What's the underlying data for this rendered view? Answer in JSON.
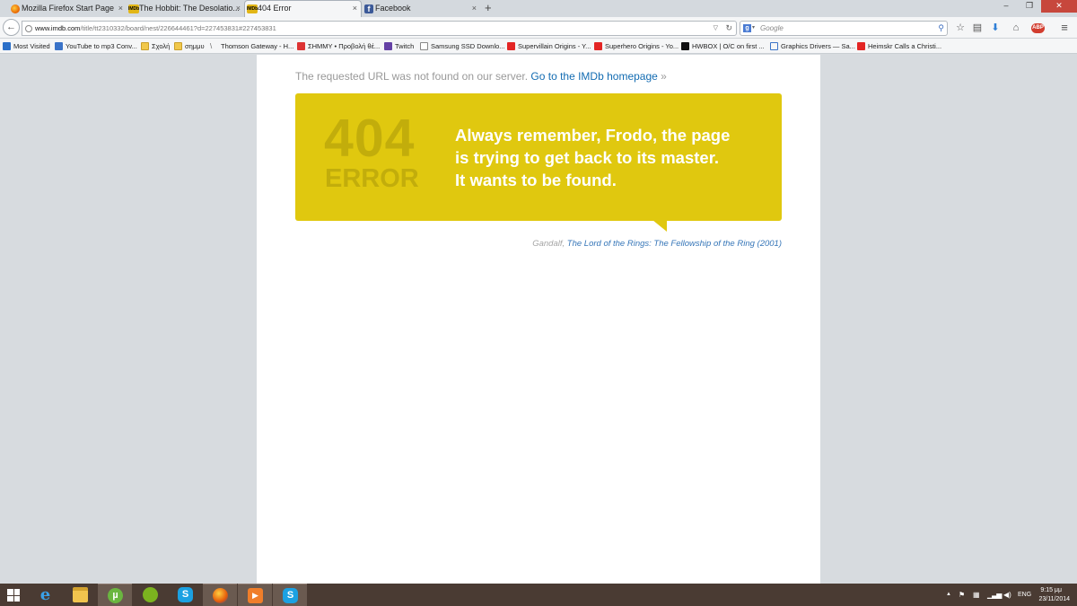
{
  "browser": {
    "tabs": [
      {
        "title": "Mozilla Firefox Start Page",
        "favicon": "firefox-icon"
      },
      {
        "title": "The Hobbit: The Desolatio...",
        "favicon": "imdb-icon"
      },
      {
        "title": "404 Error",
        "favicon": "imdb-icon"
      },
      {
        "title": "Facebook",
        "favicon": "facebook-icon"
      }
    ],
    "tab_close_glyph": "×",
    "new_tab_glyph": "+",
    "window_controls": {
      "minimize": "–",
      "restore": "❐",
      "close": "✕"
    },
    "nav": {
      "back_glyph": "←",
      "url_host": "www.imdb.com",
      "url_path": "/title/tt2310332/board/nest/226644461?d=227453831#227453831",
      "search_engine_letter": "g",
      "search_placeholder": "Google",
      "icons": [
        "star-icon",
        "reading-list-icon",
        "download-icon",
        "home-icon",
        "adblock-icon",
        "menu-icon"
      ],
      "adblock_label": "ABP"
    },
    "bookmarks": [
      {
        "label": "Most Visited",
        "icon": "gear-icon"
      },
      {
        "label": "YouTube to mp3 Conv...",
        "icon": "video-icon"
      },
      {
        "label": "Σχολή",
        "icon": "folder-icon"
      },
      {
        "label": "σημμυ",
        "icon": "folder-icon"
      },
      {
        "label": "Thomson Gateway - H...",
        "icon": "thomson-icon"
      },
      {
        "label": "ΣΗΜΜΥ • Προβολή θέ...",
        "icon": "forum-icon"
      },
      {
        "label": "Twitch",
        "icon": "twitch-icon"
      },
      {
        "label": "Samsung SSD Downlo...",
        "icon": "page-icon"
      },
      {
        "label": "Supervillain Origins - Y...",
        "icon": "youtube-icon"
      },
      {
        "label": "Superhero Origins - Yo...",
        "icon": "youtube-icon"
      },
      {
        "label": "HWBOX | O/C on first ...",
        "icon": "hwbox-icon"
      },
      {
        "label": "Graphics Drivers — Sa...",
        "icon": "nvidia-icon"
      },
      {
        "label": "Heimskr Calls a Christi...",
        "icon": "youtube-icon"
      }
    ]
  },
  "page": {
    "not_found_text": "The requested URL was not found on our server.",
    "home_link": "Go to the IMDb homepage",
    "raquo": "»",
    "error_code": "404",
    "error_word": "ERROR",
    "quote_lines": [
      "Always remember, Frodo, the page",
      "is trying to get back to its master.",
      "It wants to be found."
    ],
    "attribution_speaker": "Gandalf,",
    "attribution_source": "The Lord of the Rings: The Fellowship of the Ring (2001)",
    "colors": {
      "box_yellow": "#e0c80f",
      "box_text_muted": "#c2ad0b",
      "link_blue": "#136cb2"
    }
  },
  "taskbar": {
    "apps": [
      "start-icon",
      "internet-explorer-icon",
      "file-explorer-icon",
      "utorrent-icon",
      "spotify-icon",
      "skype-icon",
      "firefox-icon",
      "media-player-icon",
      "skype-icon"
    ],
    "utorrent_letter": "µ",
    "skype_letter": "S",
    "ie_letter": "e",
    "tray": {
      "overflow_glyph": "▲",
      "language": "ENG",
      "time": "9:15 μμ",
      "date": "23/11/2014"
    }
  }
}
